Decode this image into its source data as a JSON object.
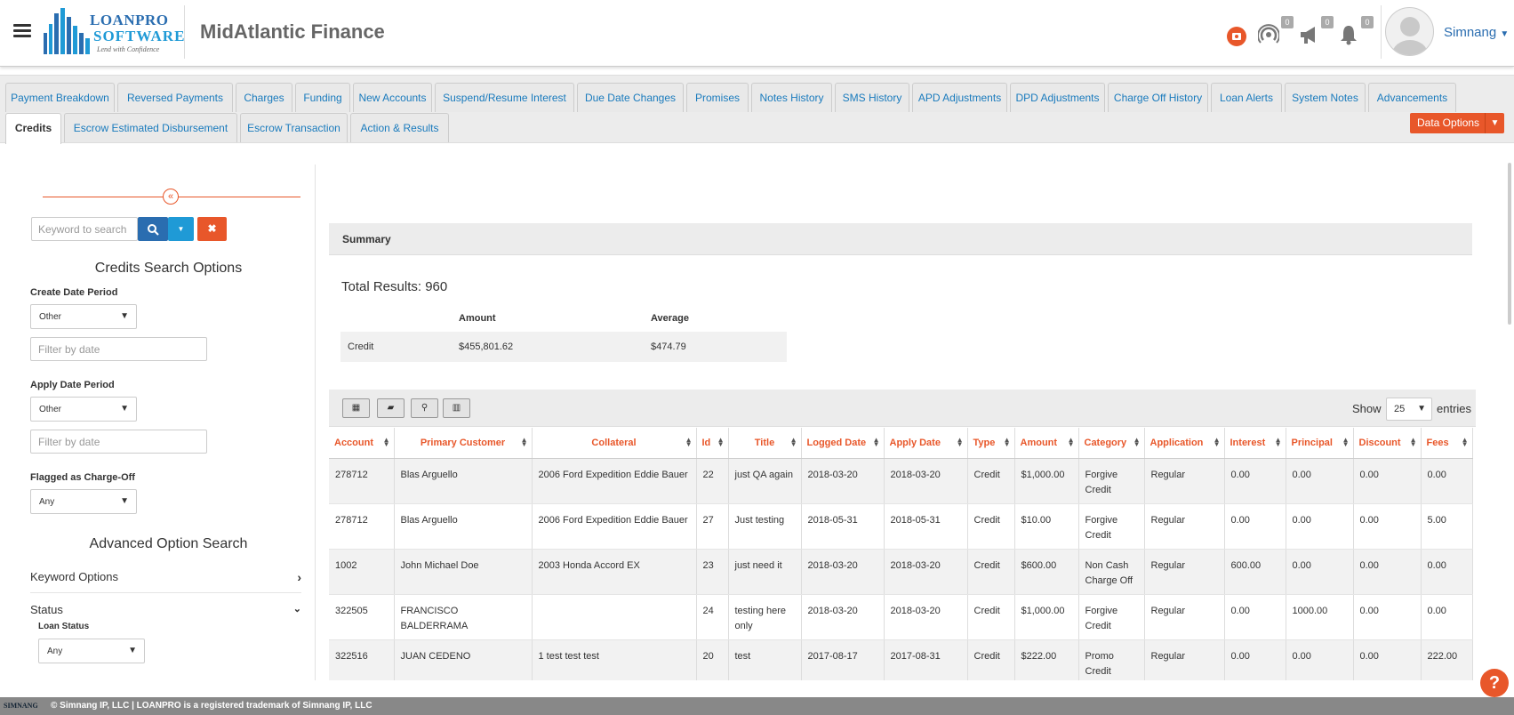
{
  "app": {
    "company": "MidAtlantic Finance",
    "logo": {
      "word1": "LOANPRO",
      "word2": "SOFTWARE",
      "tagline": "Lend with Confidence"
    },
    "user": "Simnang",
    "badges": {
      "signal": "0",
      "announcements": "0",
      "notifications": "0"
    }
  },
  "tabs_row1": [
    "Payment Breakdown",
    "Reversed Payments",
    "Charges",
    "Funding",
    "New Accounts",
    "Suspend/Resume Interest",
    "Due Date Changes",
    "Promises",
    "Notes History",
    "SMS History",
    "APD Adjustments",
    "DPD Adjustments",
    "Charge Off History",
    "Loan Alerts",
    "System Notes",
    "Advancements"
  ],
  "tabs_row2": [
    "Credits",
    "Escrow Estimated Disbursement",
    "Escrow Transaction",
    "Action & Results"
  ],
  "active_tab": "Credits",
  "data_options_label": "Data Options",
  "sidebar": {
    "keyword_placeholder": "Keyword to search",
    "title": "Credits Search Options",
    "create_date_label": "Create Date Period",
    "create_date_value": "Other",
    "create_date_filter_placeholder": "Filter by date",
    "apply_date_label": "Apply Date Period",
    "apply_date_value": "Other",
    "apply_date_filter_placeholder": "Filter by date",
    "flagged_label": "Flagged as Charge-Off",
    "flagged_value": "Any",
    "advanced_title": "Advanced Option Search",
    "keyword_options": "Keyword Options",
    "status": "Status",
    "loan_status_label": "Loan Status",
    "loan_status_value": "Any"
  },
  "summary": {
    "header": "Summary",
    "total_label": "Total Results: 960",
    "col_amount": "Amount",
    "col_average": "Average",
    "row_label": "Credit",
    "amount": "$455,801.62",
    "average": "$474.79"
  },
  "table": {
    "show_label": "Show",
    "page_size": "25",
    "entries_label": "entries",
    "columns": [
      "Account",
      "Primary Customer",
      "Collateral",
      "Id",
      "Title",
      "Logged Date",
      "Apply Date",
      "Type",
      "Amount",
      "Category",
      "Application",
      "Interest",
      "Principal",
      "Discount",
      "Fees"
    ],
    "rows": [
      [
        "278712",
        "Blas Arguello",
        "2006 Ford Expedition Eddie Bauer",
        "22",
        "just QA again",
        "2018-03-20",
        "2018-03-20",
        "Credit",
        "$1,000.00",
        "Forgive Credit",
        "Regular",
        "0.00",
        "0.00",
        "0.00",
        "0.00"
      ],
      [
        "278712",
        "Blas Arguello",
        "2006 Ford Expedition Eddie Bauer",
        "27",
        "Just testing",
        "2018-05-31",
        "2018-05-31",
        "Credit",
        "$10.00",
        "Forgive Credit",
        "Regular",
        "0.00",
        "0.00",
        "0.00",
        "5.00"
      ],
      [
        "1002",
        "John Michael Doe",
        "2003 Honda Accord EX",
        "23",
        "just need it",
        "2018-03-20",
        "2018-03-20",
        "Credit",
        "$600.00",
        "Non Cash Charge Off",
        "Regular",
        "600.00",
        "0.00",
        "0.00",
        "0.00"
      ],
      [
        "322505",
        "FRANCISCO BALDERRAMA",
        "",
        "24",
        "testing here only",
        "2018-03-20",
        "2018-03-20",
        "Credit",
        "$1,000.00",
        "Forgive Credit",
        "Regular",
        "0.00",
        "1000.00",
        "0.00",
        "0.00"
      ],
      [
        "322516",
        "JUAN CEDENO",
        "1 test test test",
        "20",
        "test",
        "2017-08-17",
        "2017-08-31",
        "Credit",
        "$222.00",
        "Promo Credit",
        "Regular",
        "0.00",
        "0.00",
        "0.00",
        "222.00"
      ]
    ]
  },
  "footer": {
    "logo_text": "SIMNANG",
    "text": "© Simnang IP, LLC | LOANPRO is a registered trademark of Simnang IP, LLC"
  }
}
